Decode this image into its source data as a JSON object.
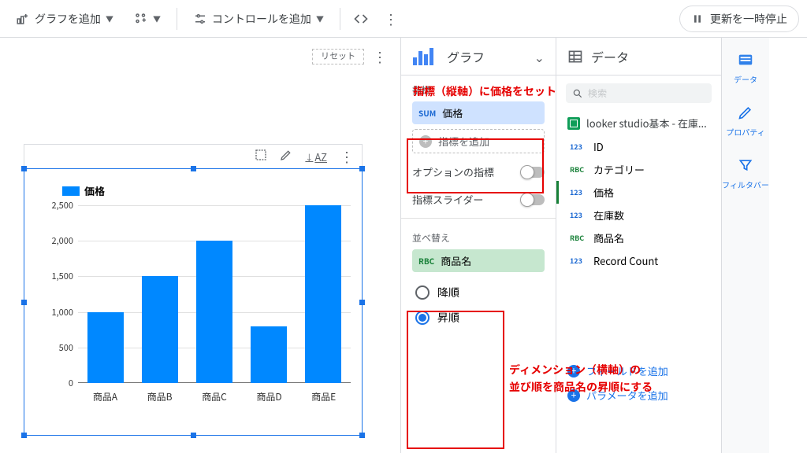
{
  "toolbar": {
    "add_chart": "グラフを追加",
    "add_control": "コントロールを追加",
    "pause_updates": "更新を一時停止"
  },
  "canvas": {
    "reset": "リセット"
  },
  "chart_toolbar": {
    "sort_az": "AZ"
  },
  "chart_data": {
    "type": "bar",
    "legend": "価格",
    "categories": [
      "商品A",
      "商品B",
      "商品C",
      "商品D",
      "商品E"
    ],
    "values": [
      1000,
      1500,
      2000,
      800,
      2500
    ],
    "ylim": [
      0,
      2500
    ],
    "ytick_step": 500,
    "yticks": [
      "0",
      "500",
      "1,000",
      "1,500",
      "2,000",
      "2,500"
    ]
  },
  "setup": {
    "panel_title": "グラフ",
    "metric_section": "指標",
    "metric_tag": "SUM",
    "metric_name": "価格",
    "add_metric": "指標を追加",
    "optional_metric": "オプションの指標",
    "metric_slider": "指標スライダー",
    "sort_section": "並べ替え",
    "sort_tag": "RBC",
    "sort_field": "商品名",
    "desc": "降順",
    "asc": "昇順"
  },
  "data": {
    "panel_title": "データ",
    "search_placeholder": "検索",
    "source": "looker studio基本 - 在庫...",
    "fields": [
      {
        "type": "123",
        "cls": "t-num",
        "name": "ID"
      },
      {
        "type": "RBC",
        "cls": "t-txt",
        "name": "カテゴリー"
      },
      {
        "type": "123",
        "cls": "t-num",
        "name": "価格",
        "sel": true
      },
      {
        "type": "123",
        "cls": "t-num",
        "name": "在庫数"
      },
      {
        "type": "RBC",
        "cls": "t-txt",
        "name": "商品名"
      },
      {
        "type": "123",
        "cls": "t-num",
        "name": "Record Count"
      }
    ],
    "add_field": "フィールドを追加",
    "add_param": "パラメータを追加"
  },
  "rail": {
    "data": "データ",
    "property": "プロパティ",
    "filterbar": "フィルタバー"
  },
  "annotations": {
    "metric_note": "指標（縦軸）に価格をセット",
    "sort_note1": "ディメンション（横軸）の",
    "sort_note2": "並び順を商品名の昇順にする"
  }
}
